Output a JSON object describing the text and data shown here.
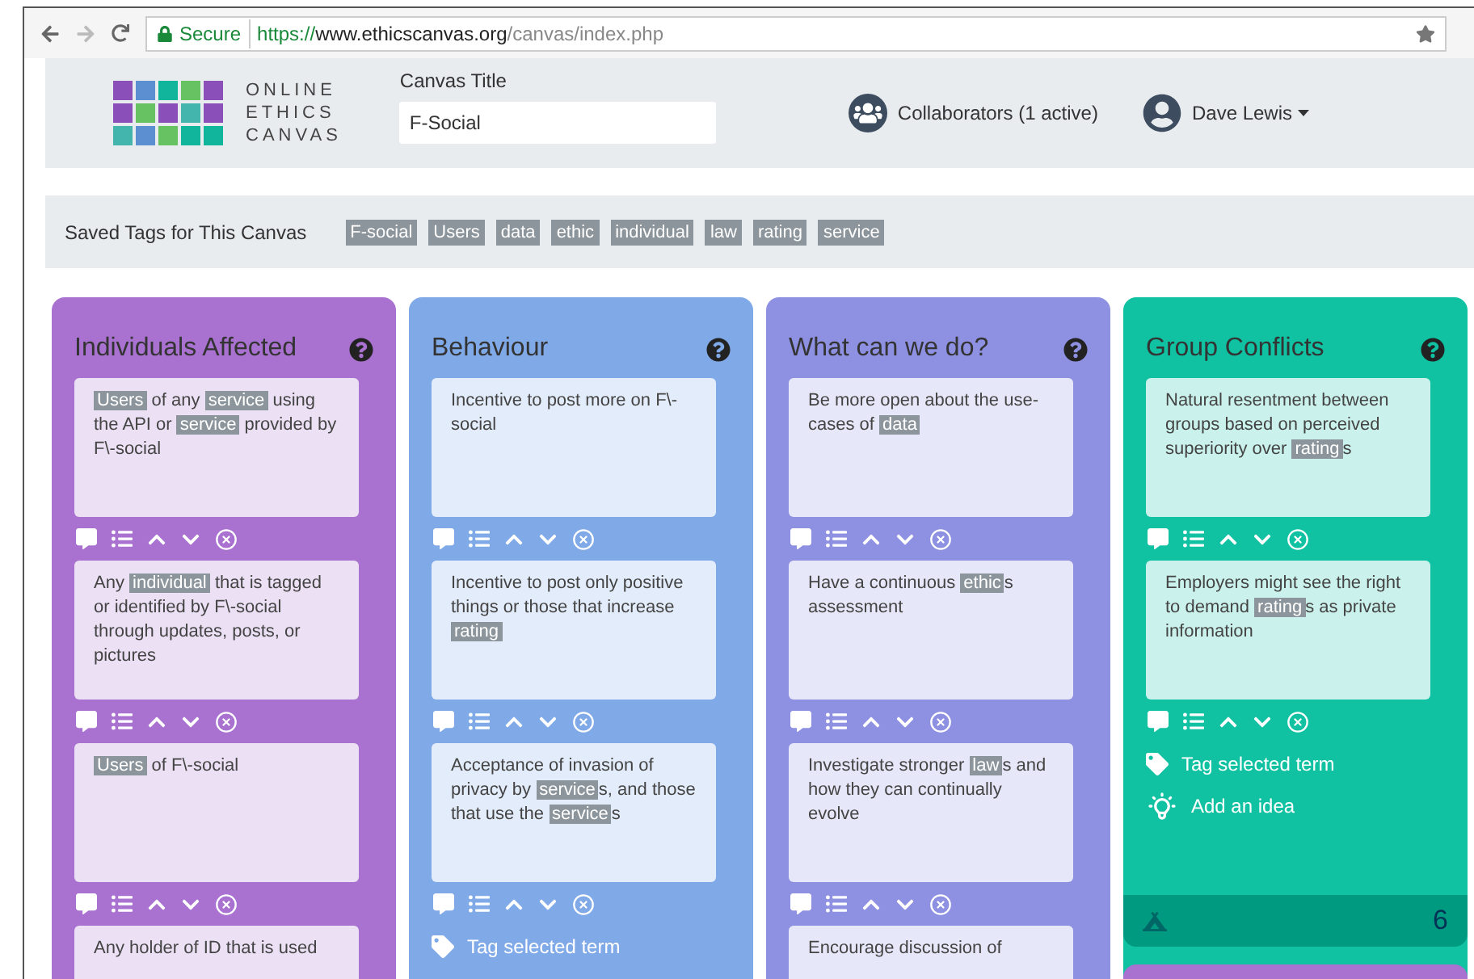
{
  "browser": {
    "secure_label": "Secure",
    "url_scheme": "https://",
    "url_host": "www.ethicscanvas.org",
    "url_path": "/canvas/index.php"
  },
  "header": {
    "logo_lines": [
      "ONLINE",
      "ETHICS",
      "CANVAS"
    ],
    "title_label": "Canvas Title",
    "title_value": "F-Social",
    "collaborators": "Collaborators (1 active)",
    "user": "Dave Lewis"
  },
  "saved_tags": {
    "label": "Saved Tags for This Canvas",
    "tags": [
      "F-social",
      "Users",
      "data",
      "ethic",
      "individual",
      "law",
      "rating",
      "service"
    ]
  },
  "columns": [
    {
      "title": "Individuals Affected",
      "color": "#aa72d0",
      "notes": [
        [
          {
            "text": "Users",
            "tagged": true
          },
          {
            "text": " of any ",
            "tagged": false
          },
          {
            "text": "service",
            "tagged": true
          },
          {
            "text": " using the API or ",
            "tagged": false
          },
          {
            "text": "service",
            "tagged": true
          },
          {
            "text": " provided by F\\-social",
            "tagged": false
          }
        ],
        [
          {
            "text": "Any ",
            "tagged": false
          },
          {
            "text": "individual",
            "tagged": true
          },
          {
            "text": " that is tagged or identified by F\\-social through updates, posts, or pictures",
            "tagged": false
          }
        ],
        [
          {
            "text": "Users",
            "tagged": true
          },
          {
            "text": " of F\\-social",
            "tagged": false
          }
        ],
        [
          {
            "text": "Any holder of ID that is used",
            "tagged": false
          }
        ]
      ]
    },
    {
      "title": "Behaviour",
      "color": "#80a9e7",
      "notes": [
        [
          {
            "text": "Incentive to post more on F\\-social",
            "tagged": false
          }
        ],
        [
          {
            "text": "Incentive to post only positive things or those that increase ",
            "tagged": false
          },
          {
            "text": "rating",
            "tagged": true
          }
        ],
        [
          {
            "text": "Acceptance of invasion of privacy by ",
            "tagged": false
          },
          {
            "text": "service",
            "tagged": true
          },
          {
            "text": "s, and those that use the ",
            "tagged": false
          },
          {
            "text": "service",
            "tagged": true
          },
          {
            "text": "s",
            "tagged": false
          }
        ]
      ],
      "actions": [
        {
          "kind": "tag",
          "label": "Tag selected term"
        }
      ]
    },
    {
      "title": "What can we do?",
      "color": "#8e90e1",
      "notes": [
        [
          {
            "text": "Be more open about the use-cases of ",
            "tagged": false
          },
          {
            "text": "data",
            "tagged": true
          }
        ],
        [
          {
            "text": "Have a continuous ",
            "tagged": false
          },
          {
            "text": "ethic",
            "tagged": true
          },
          {
            "text": "s assessment",
            "tagged": false
          }
        ],
        [
          {
            "text": "Investigate stronger ",
            "tagged": false
          },
          {
            "text": "law",
            "tagged": true
          },
          {
            "text": "s and how they can continually evolve",
            "tagged": false
          }
        ],
        [
          {
            "text": "Encourage discussion of",
            "tagged": false
          }
        ]
      ]
    },
    {
      "title": "Group Conflicts",
      "color": "#10c1a2",
      "notes": [
        [
          {
            "text": "Natural resentment between groups based on perceived superiority over ",
            "tagged": false
          },
          {
            "text": "rating",
            "tagged": true
          },
          {
            "text": "s",
            "tagged": false
          }
        ],
        [
          {
            "text": "Employers might see the right to demand ",
            "tagged": false
          },
          {
            "text": "rating",
            "tagged": true
          },
          {
            "text": "s as private information",
            "tagged": false
          }
        ]
      ],
      "actions": [
        {
          "kind": "tag",
          "label": "Tag selected term"
        },
        {
          "kind": "idea",
          "label": "Add an idea"
        }
      ],
      "footer": {
        "count": "6"
      }
    }
  ]
}
